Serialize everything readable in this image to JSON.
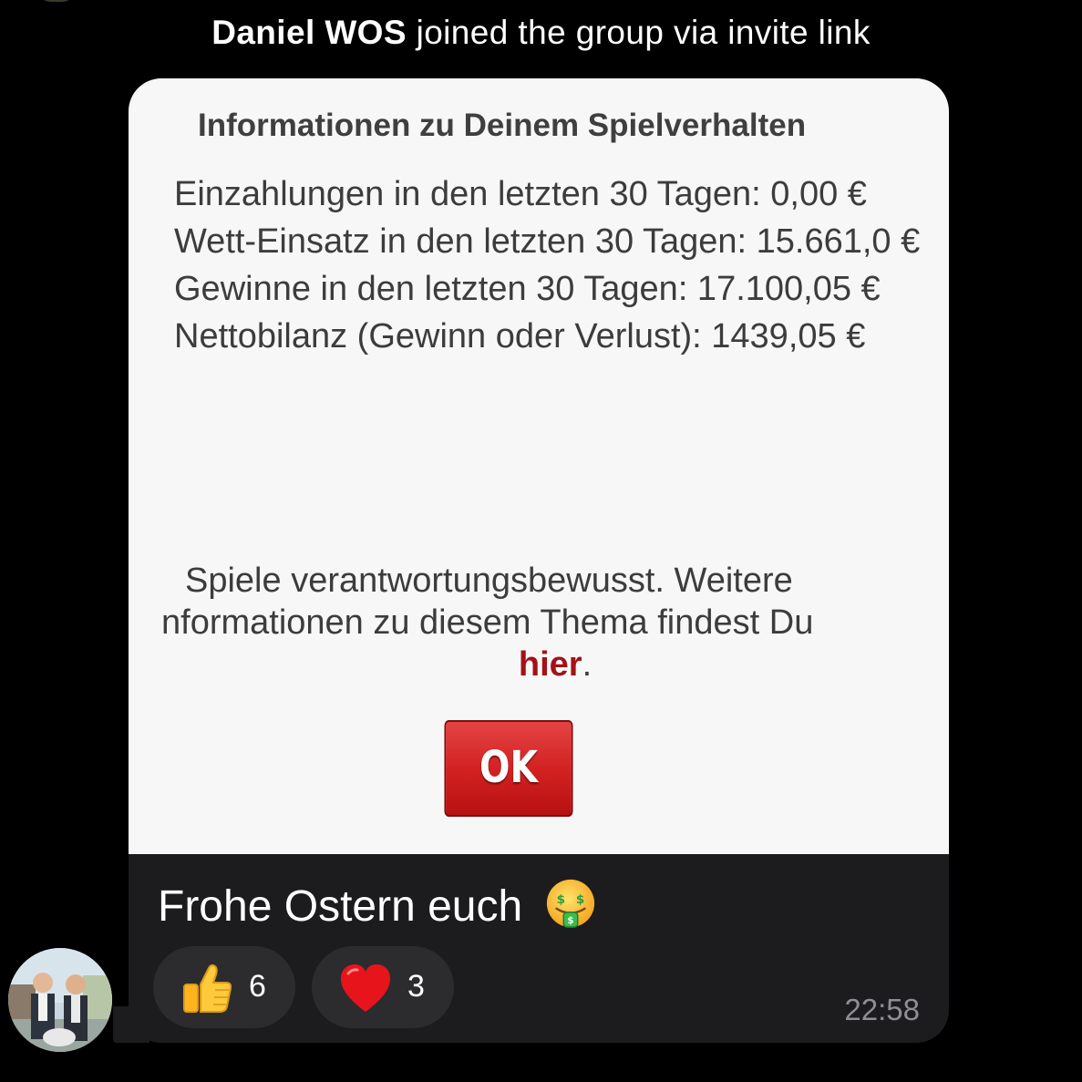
{
  "service_message": {
    "name": "Daniel WOS",
    "text": " joined the group via invite link"
  },
  "screenshot": {
    "title": "Informationen zu Deinem Spielverhalten",
    "stats": [
      "Einzahlungen in den letzten 30 Tagen: 0,00 €",
      "Wett-Einsatz in den letzten 30 Tagen: 15.661,0 €",
      "Gewinne in den letzten 30 Tagen: 17.100,05 €",
      "Nettobilanz (Gewinn oder Verlust): 1439,05 €"
    ],
    "notice_line1": "Spiele verantwortungsbewusst. Weitere",
    "notice_line2": "nformationen zu diesem Thema findest Du",
    "notice_link": "hier",
    "notice_end": ".",
    "ok_label": "OK",
    "link_color": "#a31218",
    "button_color": "#d42222"
  },
  "message": {
    "caption": "Frohe Ostern euch",
    "caption_emoji": "money-mouth-face-icon",
    "timestamp": "22:58"
  },
  "reactions": [
    {
      "icon": "thumbs-up-icon",
      "count": "6"
    },
    {
      "icon": "red-heart-icon",
      "count": "3"
    }
  ],
  "colors": {
    "background": "#000000",
    "bubble": "#1c1c1e",
    "reaction_pill": "#2c2c2e",
    "timestamp": "#8e8e93"
  }
}
